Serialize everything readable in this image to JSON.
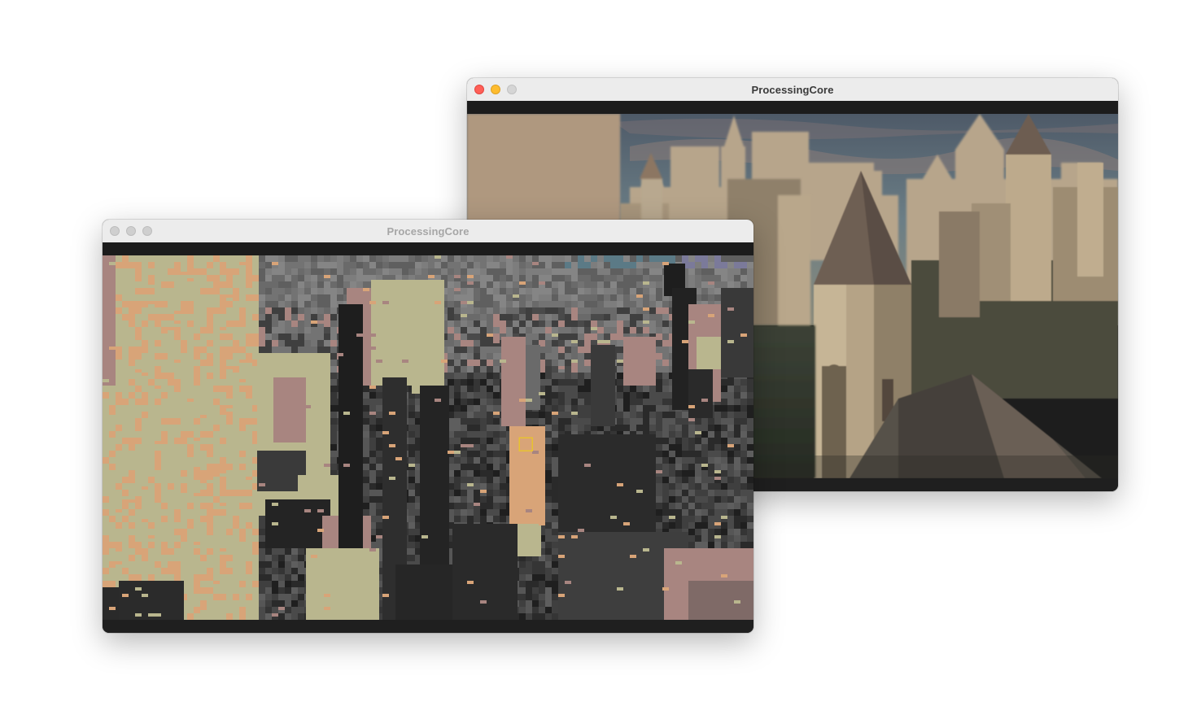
{
  "windows": [
    {
      "id": "processed-window",
      "title": "ProcessingCore",
      "state": "inactive",
      "content": "pixelated-castle-render",
      "selection_marker_color": "#e8c230"
    },
    {
      "id": "source-window",
      "title": "ProcessingCore",
      "state": "active",
      "content": "castle-photo-render"
    }
  ],
  "colors": {
    "close": "#ff5f57",
    "minimize": "#febc2e",
    "zoom": "#d5d5d5",
    "palette_sand": "#b9b68e",
    "palette_orange": "#d8a478",
    "palette_mauve": "#a88580",
    "palette_dark": "#2a2a2a",
    "sky_blue": "#5b7a86"
  }
}
